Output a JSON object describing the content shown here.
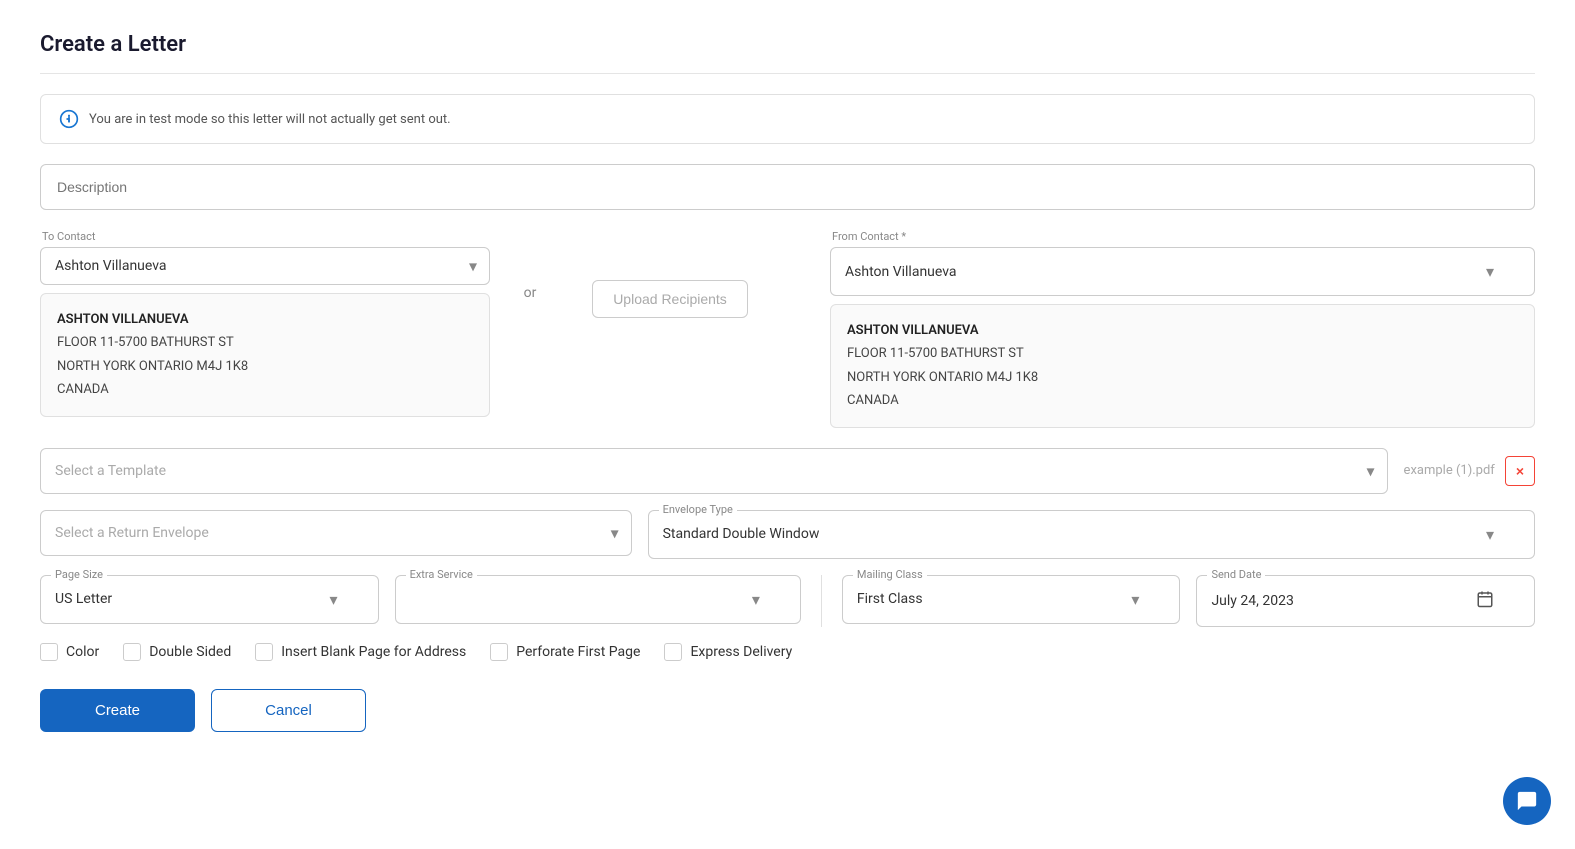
{
  "page": {
    "title": "Create a Letter"
  },
  "banner": {
    "text": "You are in test mode so this letter will not actually get sent out."
  },
  "description": {
    "placeholder": "Description"
  },
  "to_contact": {
    "label": "To Contact",
    "value": "Ashton Villanueva",
    "address": {
      "name": "ASHTON VILLANUEVA",
      "line1": "FLOOR 11-5700 BATHURST ST",
      "line2": "NORTH YORK ONTARIO M4J 1K8",
      "line3": "CANADA"
    }
  },
  "or_label": "or",
  "upload_btn": "Upload Recipients",
  "from_contact": {
    "label": "From Contact *",
    "value": "Ashton Villanueva",
    "address": {
      "name": "ASHTON VILLANUEVA",
      "line1": "FLOOR 11-5700 BATHURST ST",
      "line2": "NORTH YORK ONTARIO M4J 1K8",
      "line3": "CANADA"
    }
  },
  "template": {
    "placeholder": "Select a Template",
    "file_name": "example (1).pdf",
    "remove_btn": "×"
  },
  "return_envelope": {
    "placeholder": "Select a Return Envelope"
  },
  "envelope_type": {
    "label": "Envelope Type",
    "value": "Standard Double Window"
  },
  "page_size": {
    "label": "Page Size",
    "value": "US Letter"
  },
  "extra_service": {
    "label": "Extra Service",
    "value": ""
  },
  "mailing_class": {
    "label": "Mailing Class",
    "value": "First Class"
  },
  "send_date": {
    "label": "Send Date",
    "value": "July 24, 2023"
  },
  "checkboxes": [
    {
      "id": "color",
      "label": "Color",
      "checked": false
    },
    {
      "id": "double-sided",
      "label": "Double Sided",
      "checked": false
    },
    {
      "id": "blank-page",
      "label": "Insert Blank Page for Address",
      "checked": false
    },
    {
      "id": "perforate",
      "label": "Perforate First Page",
      "checked": false
    },
    {
      "id": "express",
      "label": "Express Delivery",
      "checked": false
    }
  ],
  "buttons": {
    "create": "Create",
    "cancel": "Cancel"
  },
  "icons": {
    "chevron_down": "▾",
    "calendar": "📅",
    "chat": "💬",
    "info_circle": "ℹ"
  },
  "colors": {
    "primary": "#1565c0",
    "danger": "#f44336",
    "text_muted": "#aaa",
    "border": "#ccc"
  }
}
